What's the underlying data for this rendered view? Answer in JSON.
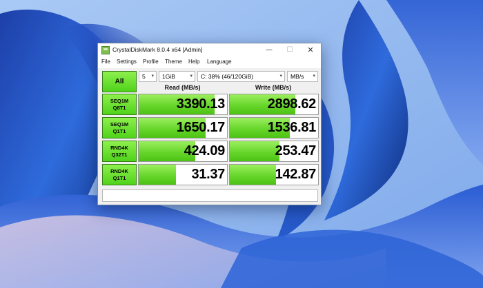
{
  "window": {
    "title": "CrystalDiskMark 8.0.4 x64 [Admin]",
    "minimize_glyph": "—",
    "maximize_glyph": "☐",
    "close_glyph": "✕"
  },
  "menu": [
    "File",
    "Settings",
    "Profile",
    "Theme",
    "Help",
    "Language"
  ],
  "controls": {
    "all_label": "All",
    "count": "5",
    "size": "1GiB",
    "drive": "C: 38% (46/120GiB)",
    "unit": "MB/s",
    "dropdown_arrow": "▾"
  },
  "columns": {
    "read": "Read (MB/s)",
    "write": "Write (MB/s)"
  },
  "tests": [
    {
      "line1": "SEQ1M",
      "line2": "Q8T1",
      "read": "3390.13",
      "write": "2898.62",
      "read_fill": 0.86,
      "write_fill": 0.74
    },
    {
      "line1": "SEQ1M",
      "line2": "Q1T1",
      "read": "1650.17",
      "write": "1536.81",
      "read_fill": 0.76,
      "write_fill": 0.68
    },
    {
      "line1": "RND4K",
      "line2": "Q32T1",
      "read": "424.09",
      "write": "253.47",
      "read_fill": 0.64,
      "write_fill": 0.56
    },
    {
      "line1": "RND4K",
      "line2": "Q1T1",
      "read": "31.37",
      "write": "142.87",
      "read_fill": 0.42,
      "write_fill": 0.52
    }
  ],
  "comment": "",
  "colors": {
    "accent_green": "#4fd31a",
    "bar_green": "#67d62c"
  }
}
